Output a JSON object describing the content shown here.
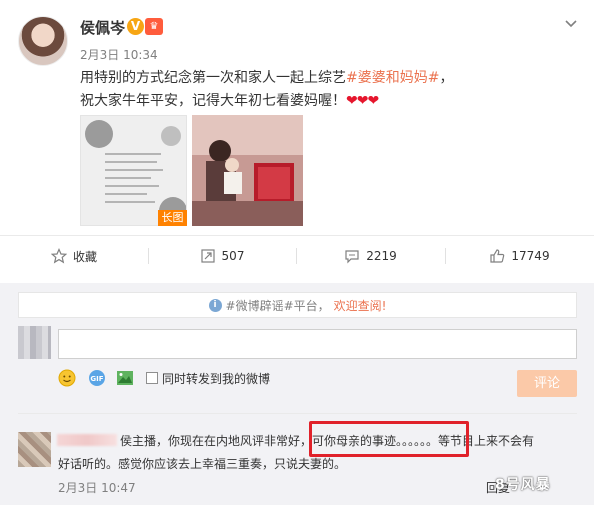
{
  "post": {
    "user_name": "侯佩岑",
    "v_badge": "V",
    "time": "2月3日 10:34",
    "text_line1_prefix": "用特别的方式纪念第一次和家人一起上综艺",
    "topic": "#婆婆和妈妈#",
    "text_line1_suffix": "，",
    "text_line2": "祝大家牛年平安，记得大年初七看婆妈喔！",
    "hearts": "❤❤❤",
    "image_badge": "长图"
  },
  "actions": {
    "favorite": "收藏",
    "repost": "507",
    "comment": "2219",
    "like": "17749"
  },
  "notice": {
    "prefix": "#微博辟谣#平台，",
    "highlight": "欢迎查阅!"
  },
  "composer": {
    "input_value": "",
    "sync_label": "同时转发到我的微博",
    "submit_label": "评论"
  },
  "comment": {
    "line1": "侯主播，你现在在内地风评非常好，可你母亲的事迹。。。。。。等节目上来不会有",
    "line2": "好话听的。感觉你应该去上幸福三重奏，只说夫妻的。",
    "time": "2月3日 10:47",
    "reply": "回复",
    "watermark": "8号风暴"
  },
  "colors": {
    "topic": "#eb7350",
    "submit_disabled": "#fbc9a8",
    "highlight_box": "#e0212a"
  }
}
